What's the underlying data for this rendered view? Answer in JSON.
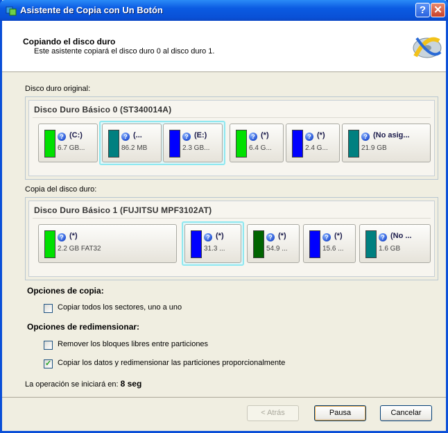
{
  "window": {
    "title": "Asistente de Copia con Un Botón",
    "help_btn": "?",
    "close_btn": "✕"
  },
  "header": {
    "title": "Copiando el disco duro",
    "subtitle": "Este asistente copiará el disco duro 0 al disco duro 1."
  },
  "source": {
    "label": "Disco duro original:",
    "disk_title": "Disco Duro Básico 0 (ST340014A)",
    "partitions": [
      {
        "name": "(C:)",
        "size": "6.7 GB...",
        "color": "#00e000"
      },
      {
        "name": "(...",
        "size": "86.2 MB",
        "color": "#008080"
      },
      {
        "name": "(E:)",
        "size": "2.3 GB...",
        "color": "#0000ff"
      },
      {
        "name": "(*)",
        "size": "6.4 G...",
        "color": "#00e000"
      },
      {
        "name": "(*)",
        "size": "2.4 G...",
        "color": "#0000ff"
      },
      {
        "name": "(No asig...",
        "size": "21.9 GB",
        "color": "#008080"
      }
    ]
  },
  "target": {
    "label": "Copia del disco duro:",
    "disk_title": "Disco Duro Básico 1 (FUJITSU MPF3102AT)",
    "partitions": [
      {
        "name": "(*)",
        "size": "2.2 GB FAT32",
        "color": "#00e000"
      },
      {
        "name": "(*)",
        "size": "31.3 ...",
        "color": "#0000ff"
      },
      {
        "name": "(*)",
        "size": "54.9 ...",
        "color": "#006400"
      },
      {
        "name": "(*)",
        "size": "15.6 ...",
        "color": "#0000ff"
      },
      {
        "name": "(No ...",
        "size": "1.6 GB",
        "color": "#008080"
      }
    ]
  },
  "copy_options": {
    "title": "Opciones de copia:",
    "sector_by_sector": {
      "label": "Copiar todos los sectores, uno a uno",
      "checked": false
    }
  },
  "resize_options": {
    "title": "Opciones de redimensionar:",
    "remove_free": {
      "label": "Remover los bloques libres entre particiones",
      "checked": false
    },
    "proportional": {
      "label": "Copiar los datos y redimensionar las particiones proporcionalmente",
      "checked": true
    }
  },
  "status": {
    "text": "La operación se iniciará en:",
    "countdown": "8 seg"
  },
  "buttons": {
    "back": "< Atrás",
    "pause": "Pausa",
    "cancel": "Cancelar"
  }
}
